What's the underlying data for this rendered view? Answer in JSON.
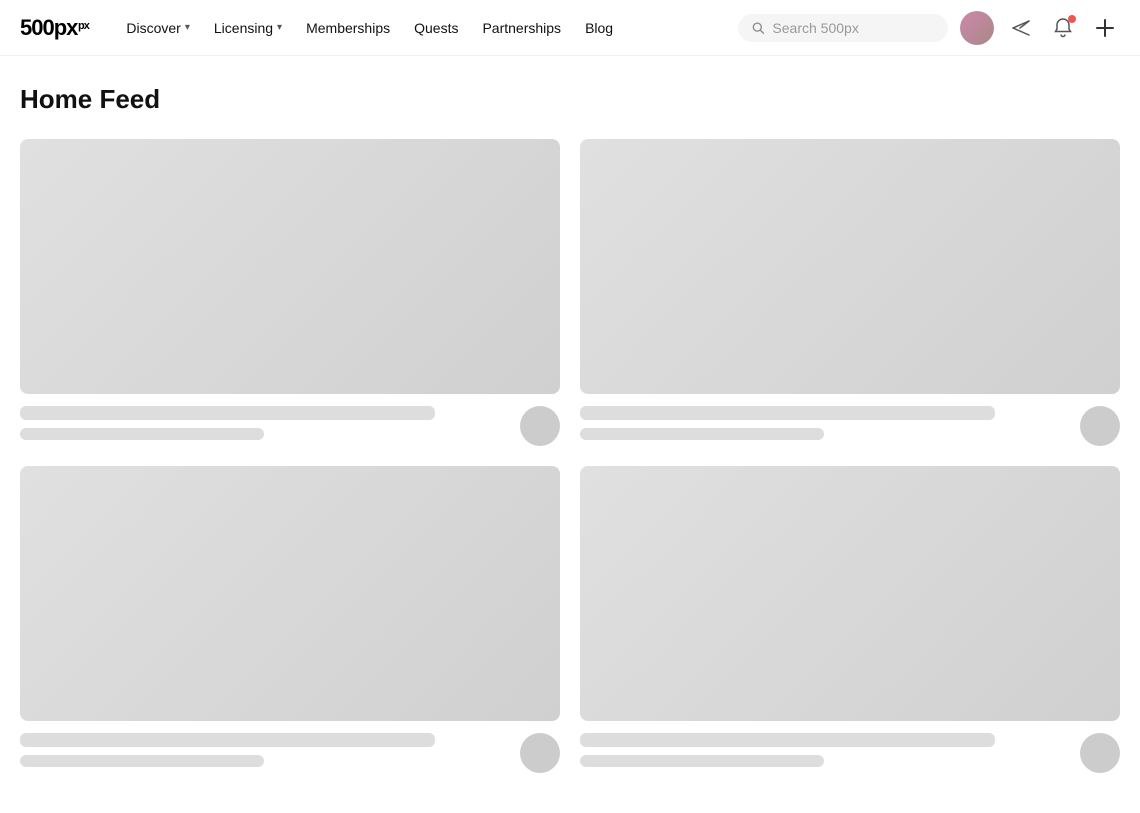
{
  "logo": {
    "text": "500px",
    "superscript": ""
  },
  "nav": {
    "discover_label": "Discover",
    "licensing_label": "Licensing",
    "memberships_label": "Memberships",
    "quests_label": "Quests",
    "partnerships_label": "Partnerships",
    "blog_label": "Blog"
  },
  "search": {
    "placeholder": "Search 500px"
  },
  "page": {
    "title": "Home Feed"
  },
  "feed": {
    "cards": [
      {
        "id": 1
      },
      {
        "id": 2
      },
      {
        "id": 3
      },
      {
        "id": 4
      }
    ]
  }
}
